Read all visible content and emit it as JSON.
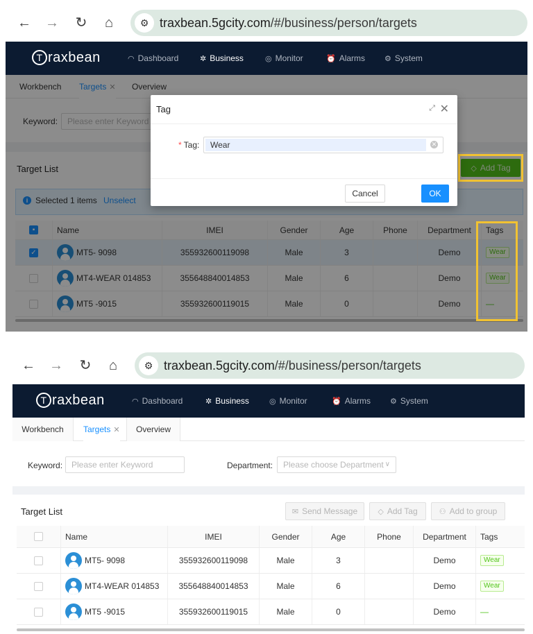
{
  "browser": {
    "domain": "traxbean.5gcity.com",
    "path": "/#/business/person/targets"
  },
  "app": {
    "logo": "raxbean",
    "logo_mark": "T",
    "menu": [
      {
        "label": "Dashboard",
        "icon": "dashboard-icon"
      },
      {
        "label": "Business",
        "icon": "business-icon"
      },
      {
        "label": "Monitor",
        "icon": "location-pin-icon"
      },
      {
        "label": "Alarms",
        "icon": "alarm-clock-icon"
      },
      {
        "label": "System",
        "icon": "gear-icon"
      }
    ]
  },
  "tabs": [
    "Workbench",
    "Targets",
    "Overview"
  ],
  "filter": {
    "keyword_label": "Keyword:",
    "keyword_placeholder": "Please enter Keyword",
    "department_label": "Department:",
    "department_placeholder": "Please choose Department"
  },
  "list": {
    "title": "Target List",
    "buttons": {
      "send_message": "Send Message",
      "add_tag": "Add Tag",
      "add_to_group": "Add to group"
    },
    "selection": {
      "text": "Selected 1 items",
      "unselect": "Unselect"
    },
    "columns": [
      "Name",
      "IMEI",
      "Gender",
      "Age",
      "Phone",
      "Department",
      "Tags"
    ],
    "rows": [
      {
        "name": "MT5- 9098",
        "imei": "355932600119098",
        "gender": "Male",
        "age": "3",
        "phone": "",
        "department": "Demo",
        "tag": "Wear"
      },
      {
        "name": "MT4-WEAR 014853",
        "imei": "355648840014853",
        "gender": "Male",
        "age": "6",
        "phone": "",
        "department": "Demo",
        "tag": "Wear"
      },
      {
        "name": "MT5 -9015",
        "imei": "355932600119015",
        "gender": "Male",
        "age": "0",
        "phone": "",
        "department": "Demo",
        "tag": "—"
      }
    ]
  },
  "dialog": {
    "title": "Tag",
    "field_label": "Tag:",
    "field_value": "Wear",
    "cancel": "Cancel",
    "ok": "OK"
  }
}
